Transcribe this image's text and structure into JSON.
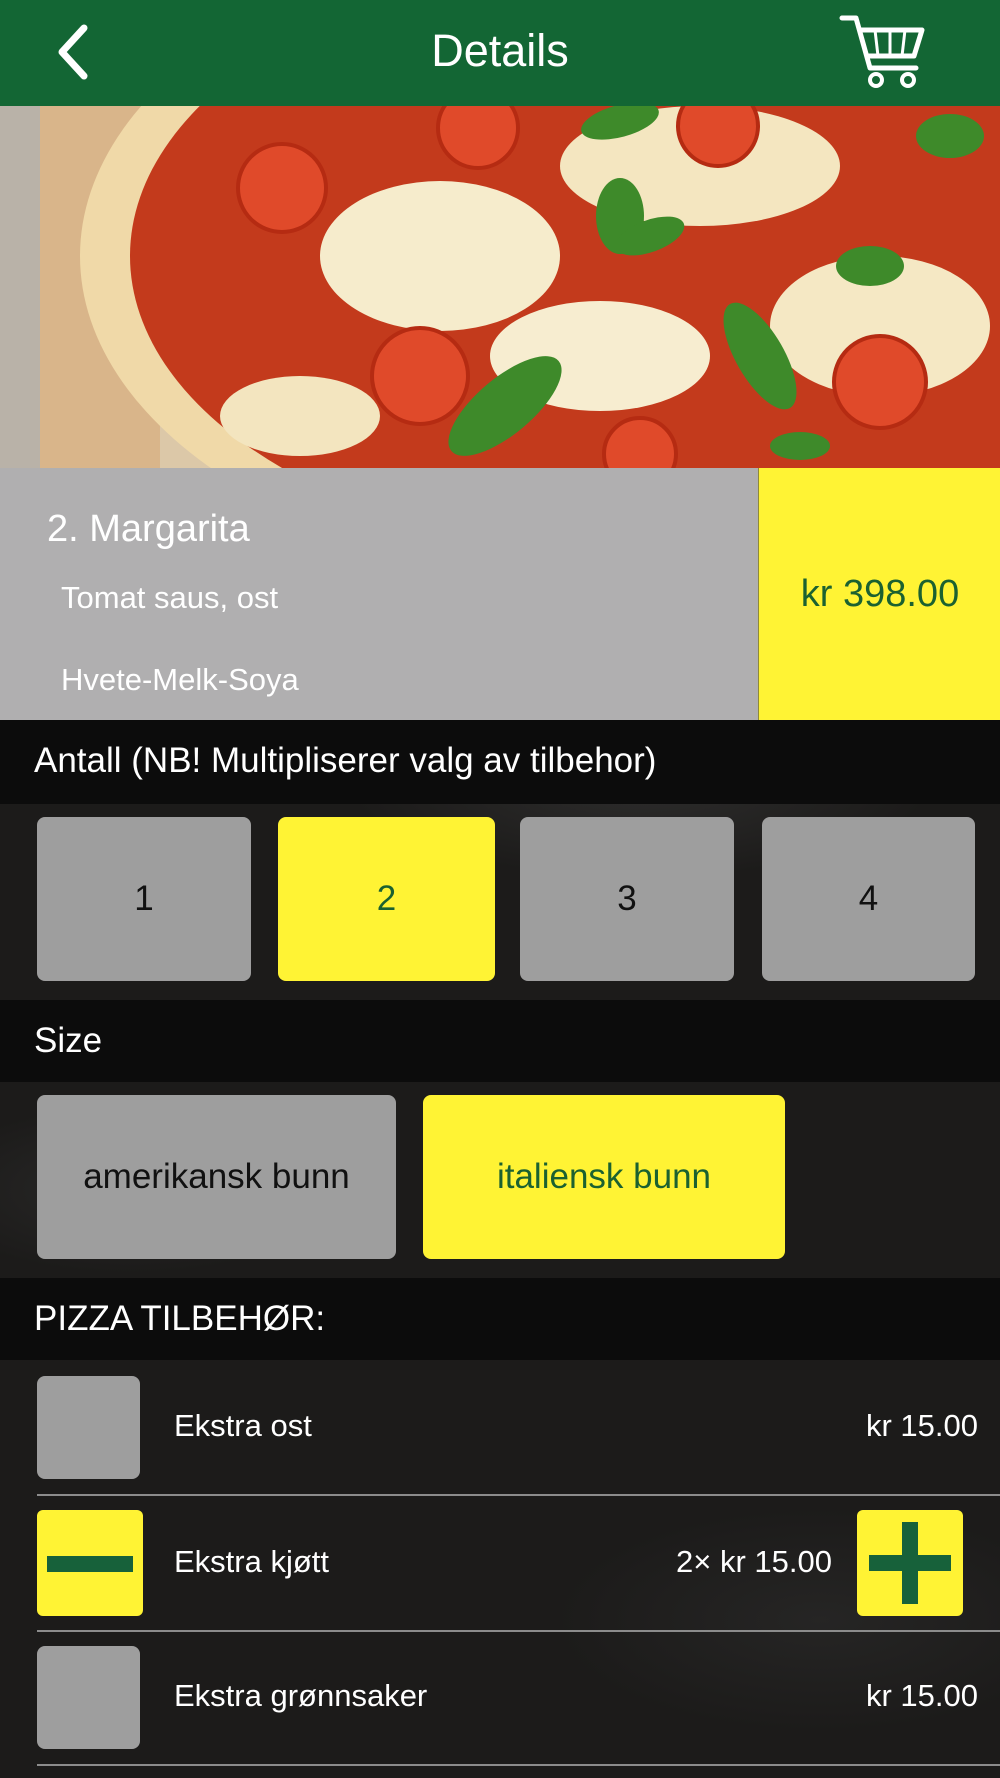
{
  "header": {
    "title": "Details",
    "back_icon": "chevron-left-icon",
    "cart_icon": "cart-icon",
    "color": "#136634"
  },
  "product": {
    "name": "2. Margarita",
    "description": "Tomat saus, ost",
    "allergens": "Hvete-Melk-Soya",
    "price": "kr 398.00"
  },
  "quantity": {
    "heading": "Antall (NB! Multipliserer valg av tilbehor)",
    "options": [
      "1",
      "2",
      "3",
      "4"
    ],
    "selected": "2"
  },
  "size": {
    "heading": "Size",
    "options": [
      "amerikansk bunn",
      "italiensk bunn"
    ],
    "selected": "italiensk bunn"
  },
  "addons": {
    "heading": "PIZZA TILBEHØR:",
    "items": [
      {
        "name": "Ekstra ost",
        "price": "kr 15.00",
        "count": 0
      },
      {
        "name": "Ekstra kjøtt",
        "price": "2× kr 15.00",
        "count": 2
      },
      {
        "name": "Ekstra grønnsaker",
        "price": "kr 15.00",
        "count": 0
      }
    ]
  },
  "colors": {
    "accent_yellow": "#fff334",
    "brand_green": "#136634",
    "option_gray": "#9e9e9e"
  }
}
